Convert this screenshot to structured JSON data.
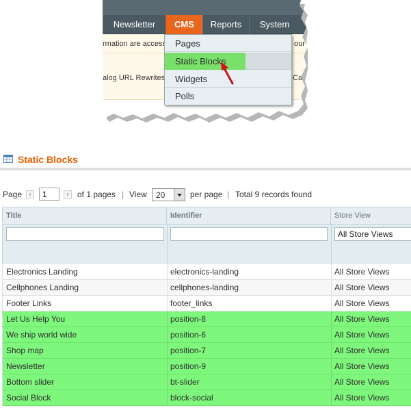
{
  "nav": {
    "items": [
      "Newsletter",
      "CMS",
      "Reports",
      "System"
    ],
    "active": "CMS"
  },
  "notices": {
    "line1_fragment": "rmation are access",
    "line1_right": "our",
    "line2_fragment": "alog URL Rewrites,",
    "line2_right": "Cate"
  },
  "cms_menu": {
    "items": [
      "Pages",
      "Static Blocks",
      "Widgets",
      "Polls"
    ],
    "highlighted": "Static Blocks"
  },
  "page": {
    "title": "Static Blocks",
    "title_icon": "grid-icon"
  },
  "pager": {
    "page_label": "Page",
    "current_page": "1",
    "of_pages": "of 1 pages",
    "separator": "|",
    "view_label": "View",
    "per_page": "20",
    "per_page_label": "per page",
    "total_records": "Total 9 records found"
  },
  "grid": {
    "columns": [
      "Title",
      "Identifier",
      "Store View"
    ],
    "store_view_filter": "All Store Views",
    "rows": [
      {
        "title": "Electronics Landing",
        "identifier": "electronics-landing",
        "store_view": "All Store Views",
        "highlighted": false
      },
      {
        "title": "Cellphones Landing",
        "identifier": "cellphones-landing",
        "store_view": "All Store Views",
        "highlighted": false
      },
      {
        "title": "Footer Links",
        "identifier": "footer_links",
        "store_view": "All Store Views",
        "highlighted": false
      },
      {
        "title": "Let Us Help You",
        "identifier": "position-8",
        "store_view": "All Store Views",
        "highlighted": true
      },
      {
        "title": "We ship world wide",
        "identifier": "position-6",
        "store_view": "All Store Views",
        "highlighted": true
      },
      {
        "title": "Shop map",
        "identifier": "position-7",
        "store_view": "All Store Views",
        "highlighted": true
      },
      {
        "title": "Newsletter",
        "identifier": "position-9",
        "store_view": "All Store Views",
        "highlighted": true
      },
      {
        "title": "Bottom slider",
        "identifier": "bt-slider",
        "store_view": "All Store Views",
        "highlighted": true
      },
      {
        "title": "Social Block",
        "identifier": "block-social",
        "store_view": "All Store Views",
        "highlighted": true
      }
    ]
  },
  "colors": {
    "brand_orange": "#eb5e00",
    "nav_active": "#e9661d",
    "menu_highlight": "#79e16b",
    "row_highlight": "#7ef77c",
    "arrow": "#d0101c"
  }
}
